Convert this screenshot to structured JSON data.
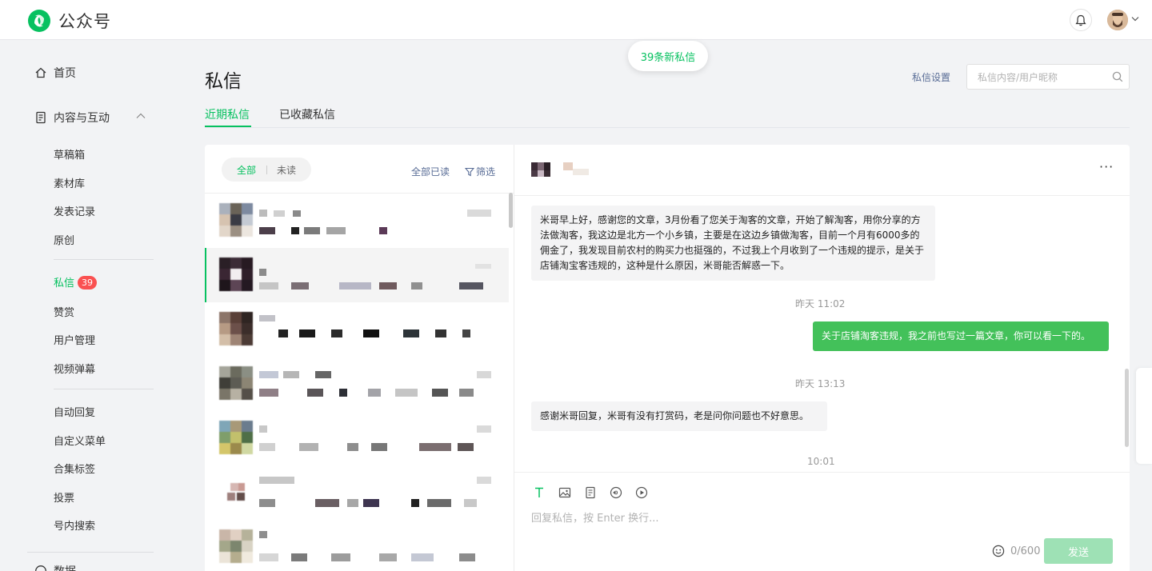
{
  "app": {
    "name": "公众号"
  },
  "colors": {
    "accent": "#07c160",
    "link": "#576b95",
    "badge": "#fa5151",
    "sent_bubble": "#43c15a"
  },
  "sidebar": {
    "home": "首页",
    "content_group": "内容与互动",
    "items_a": [
      "草稿箱",
      "素材库",
      "发表记录",
      "原创"
    ],
    "messages": {
      "label": "私信",
      "badge": "39"
    },
    "items_b": [
      "赞赏",
      "用户管理",
      "视频弹幕"
    ],
    "items_c": [
      "自动回复",
      "自定义菜单",
      "合集标签",
      "投票",
      "号内搜索"
    ],
    "data_group": "数据"
  },
  "page": {
    "title": "私信",
    "new_pill": "39条新私信",
    "settings_link": "私信设置",
    "search_placeholder": "私信内容/用户昵称",
    "tabs": [
      "近期私信",
      "已收藏私信"
    ]
  },
  "list": {
    "filter_all": "全部",
    "filter_unread": "未读",
    "mark_all_read": "全部已读",
    "filter": "筛选"
  },
  "chat": {
    "messages": [
      {
        "dir": "in",
        "text": "米哥早上好，感谢您的文章，3月份看了您关于淘客的文章，开始了解淘客，用你分享的方法做淘客，我这边是北方一个小乡镇，主要是在这边乡镇做淘客，目前一个月有6000多的佣金了，我发现目前农村的购买力也挺强的，不过我上个月收到了一个违规的提示，是关于店铺淘宝客违规的，这种是什么原因，米哥能否解惑一下。"
      },
      {
        "dir": "time",
        "text": "昨天 11:02"
      },
      {
        "dir": "out",
        "text": "关于店铺淘客违规，我之前也写过一篇文章，你可以看一下的。"
      },
      {
        "dir": "time",
        "text": "昨天 13:13"
      },
      {
        "dir": "in",
        "text": "感谢米哥回复，米哥有没有打赏码，老是问你问题也不好意思。"
      },
      {
        "dir": "time",
        "text": "10:01"
      }
    ],
    "reply_placeholder": "回复私信，按 Enter 换行...",
    "counter": "0/600",
    "send": "发送"
  }
}
